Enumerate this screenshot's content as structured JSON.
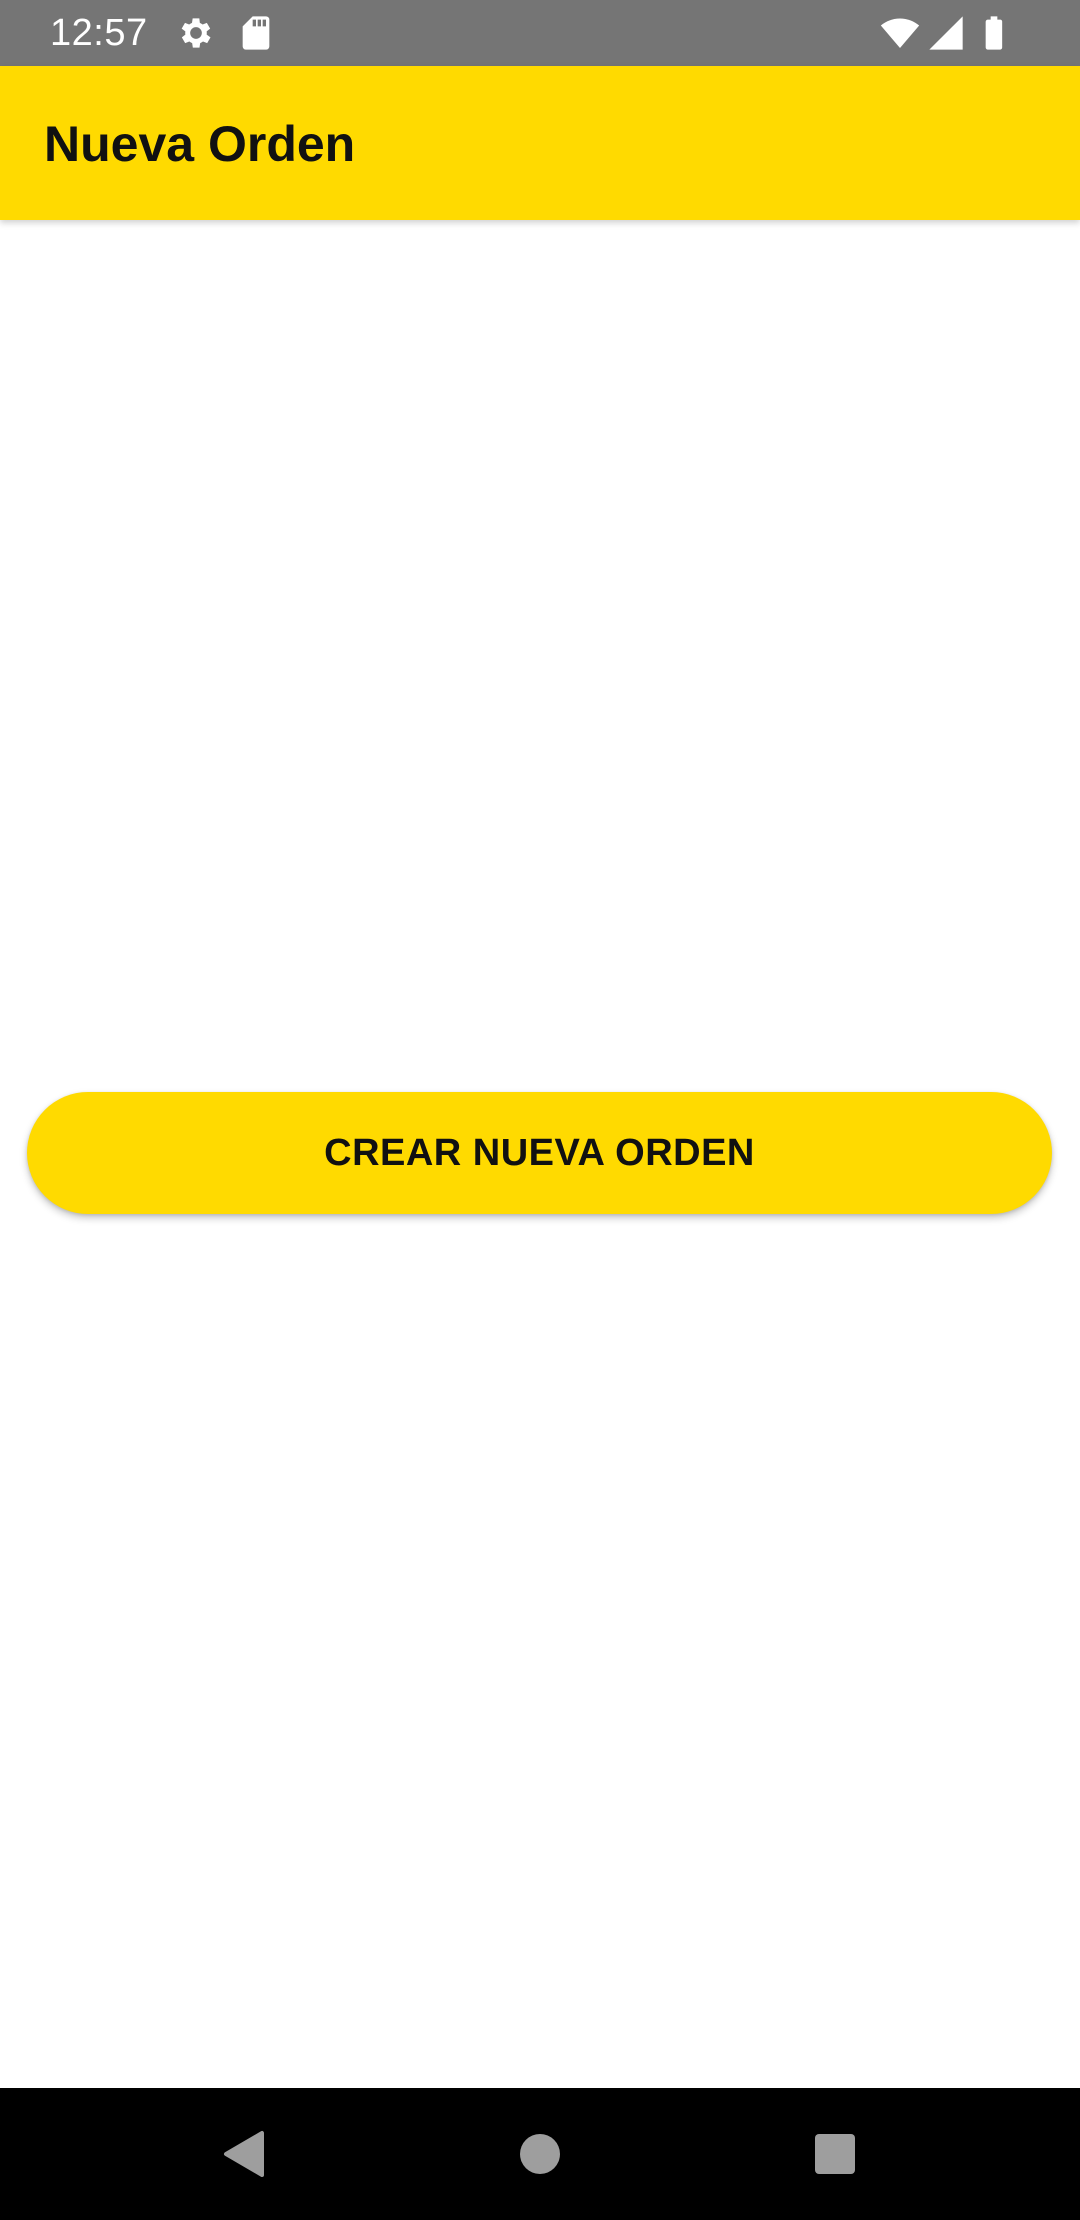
{
  "status_bar": {
    "time": "12:57",
    "icons": [
      "settings-icon",
      "sd-card-icon",
      "wifi-icon",
      "signal-icon",
      "battery-icon"
    ]
  },
  "app_bar": {
    "title": "Nueva Orden"
  },
  "main": {
    "create_button_label": "CREAR NUEVA ORDEN"
  },
  "nav_bar": {
    "icons": [
      "back-icon",
      "home-icon",
      "recents-icon"
    ]
  },
  "colors": {
    "accent": "#FFDA00",
    "status_bar": "#757575",
    "nav_bar": "#000000",
    "background": "#FFFFFF"
  }
}
